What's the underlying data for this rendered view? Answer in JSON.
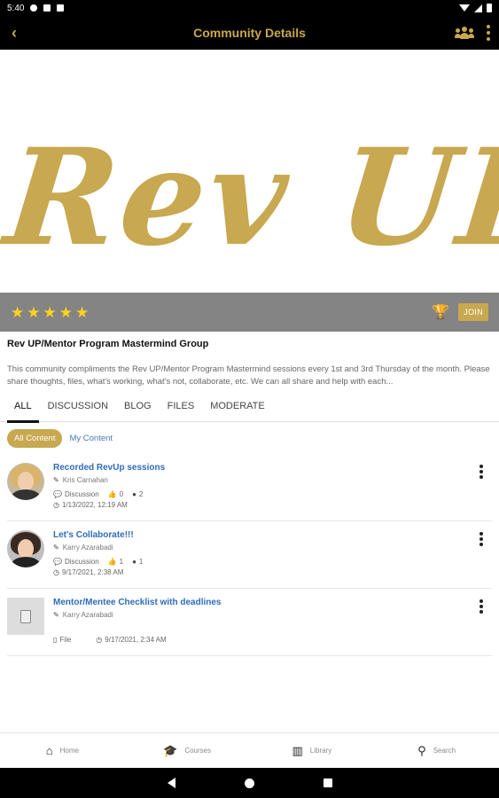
{
  "status_bar": {
    "time": "5:40"
  },
  "app_bar": {
    "title": "Community Details",
    "back_icon": "chevron-left",
    "group_icon": "users-icon",
    "menu_icon": "more-vertical-icon"
  },
  "banner": {
    "logo_text": "Rev UP!",
    "rating": 5,
    "max_rating": 5,
    "join_label": "JOIN",
    "accent": "#c8a850"
  },
  "group": {
    "title": "Rev UP/Mentor Program Mastermind Group",
    "description": "This community compliments the Rev UP/Mentor Program Mastermind sessions every 1st and 3rd Thursday of the month. Please share thoughts, files, what's working, what's not, collaborate, etc. We can all share and help with each..."
  },
  "tabs": [
    "ALL",
    "DISCUSSION",
    "BLOG",
    "FILES",
    "MODERATE"
  ],
  "filters": {
    "active": "All Content",
    "other": "My Content"
  },
  "items": [
    {
      "title": "Recorded RevUp sessions",
      "author": "Kris Carnahan",
      "type": "Discussion",
      "likes": "0",
      "comments": "2",
      "date": "1/13/2022, 12:19 AM"
    },
    {
      "title": "Let's Collaborate!!!",
      "author": "Karry Azarabadi",
      "type": "Discussion",
      "likes": "1",
      "comments": "1",
      "date": "9/17/2021, 2:38 AM"
    },
    {
      "title": "Mentor/Mentee Checklist with deadlines",
      "author": "Karry Azarabadi",
      "type": "File",
      "date": "9/17/2021, 2:34 AM"
    }
  ],
  "bottom_nav": [
    {
      "label": "Home",
      "icon": "home-icon"
    },
    {
      "label": "Courses",
      "icon": "graduation-cap-icon"
    },
    {
      "label": "Library",
      "icon": "library-icon"
    },
    {
      "label": "Search",
      "icon": "search-icon"
    }
  ]
}
